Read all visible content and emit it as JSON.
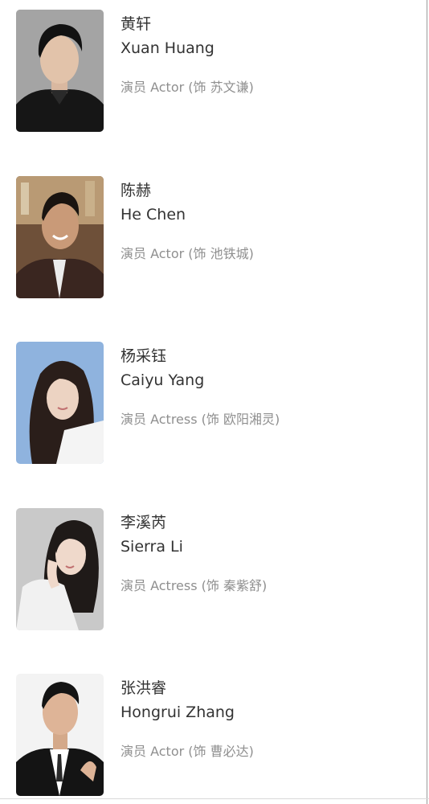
{
  "cast": [
    {
      "name_cn": "黄轩",
      "name_en": "Xuan Huang",
      "role": "演员 Actor (饰 苏文谦)",
      "photo_icon": "actor-portrait",
      "photo_bg": "#9a9a9a"
    },
    {
      "name_cn": "陈赫",
      "name_en": "He Chen",
      "role": "演员 Actor (饰 池铁城)",
      "photo_icon": "actor-portrait",
      "photo_bg": "#7a5a40"
    },
    {
      "name_cn": "杨采钰",
      "name_en": "Caiyu Yang",
      "role": "演员 Actress (饰 欧阳湘灵)",
      "photo_icon": "actress-portrait",
      "photo_bg": "#8fb3de"
    },
    {
      "name_cn": "李溪芮",
      "name_en": "Sierra Li",
      "role": "演员 Actress (饰 秦紫舒)",
      "photo_icon": "actress-portrait",
      "photo_bg": "#c8c8c8"
    },
    {
      "name_cn": "张洪睿",
      "name_en": "Hongrui Zhang",
      "role": "演员 Actor (饰 曹必达)",
      "photo_icon": "actor-portrait",
      "photo_bg": "#f2f2f2"
    }
  ]
}
